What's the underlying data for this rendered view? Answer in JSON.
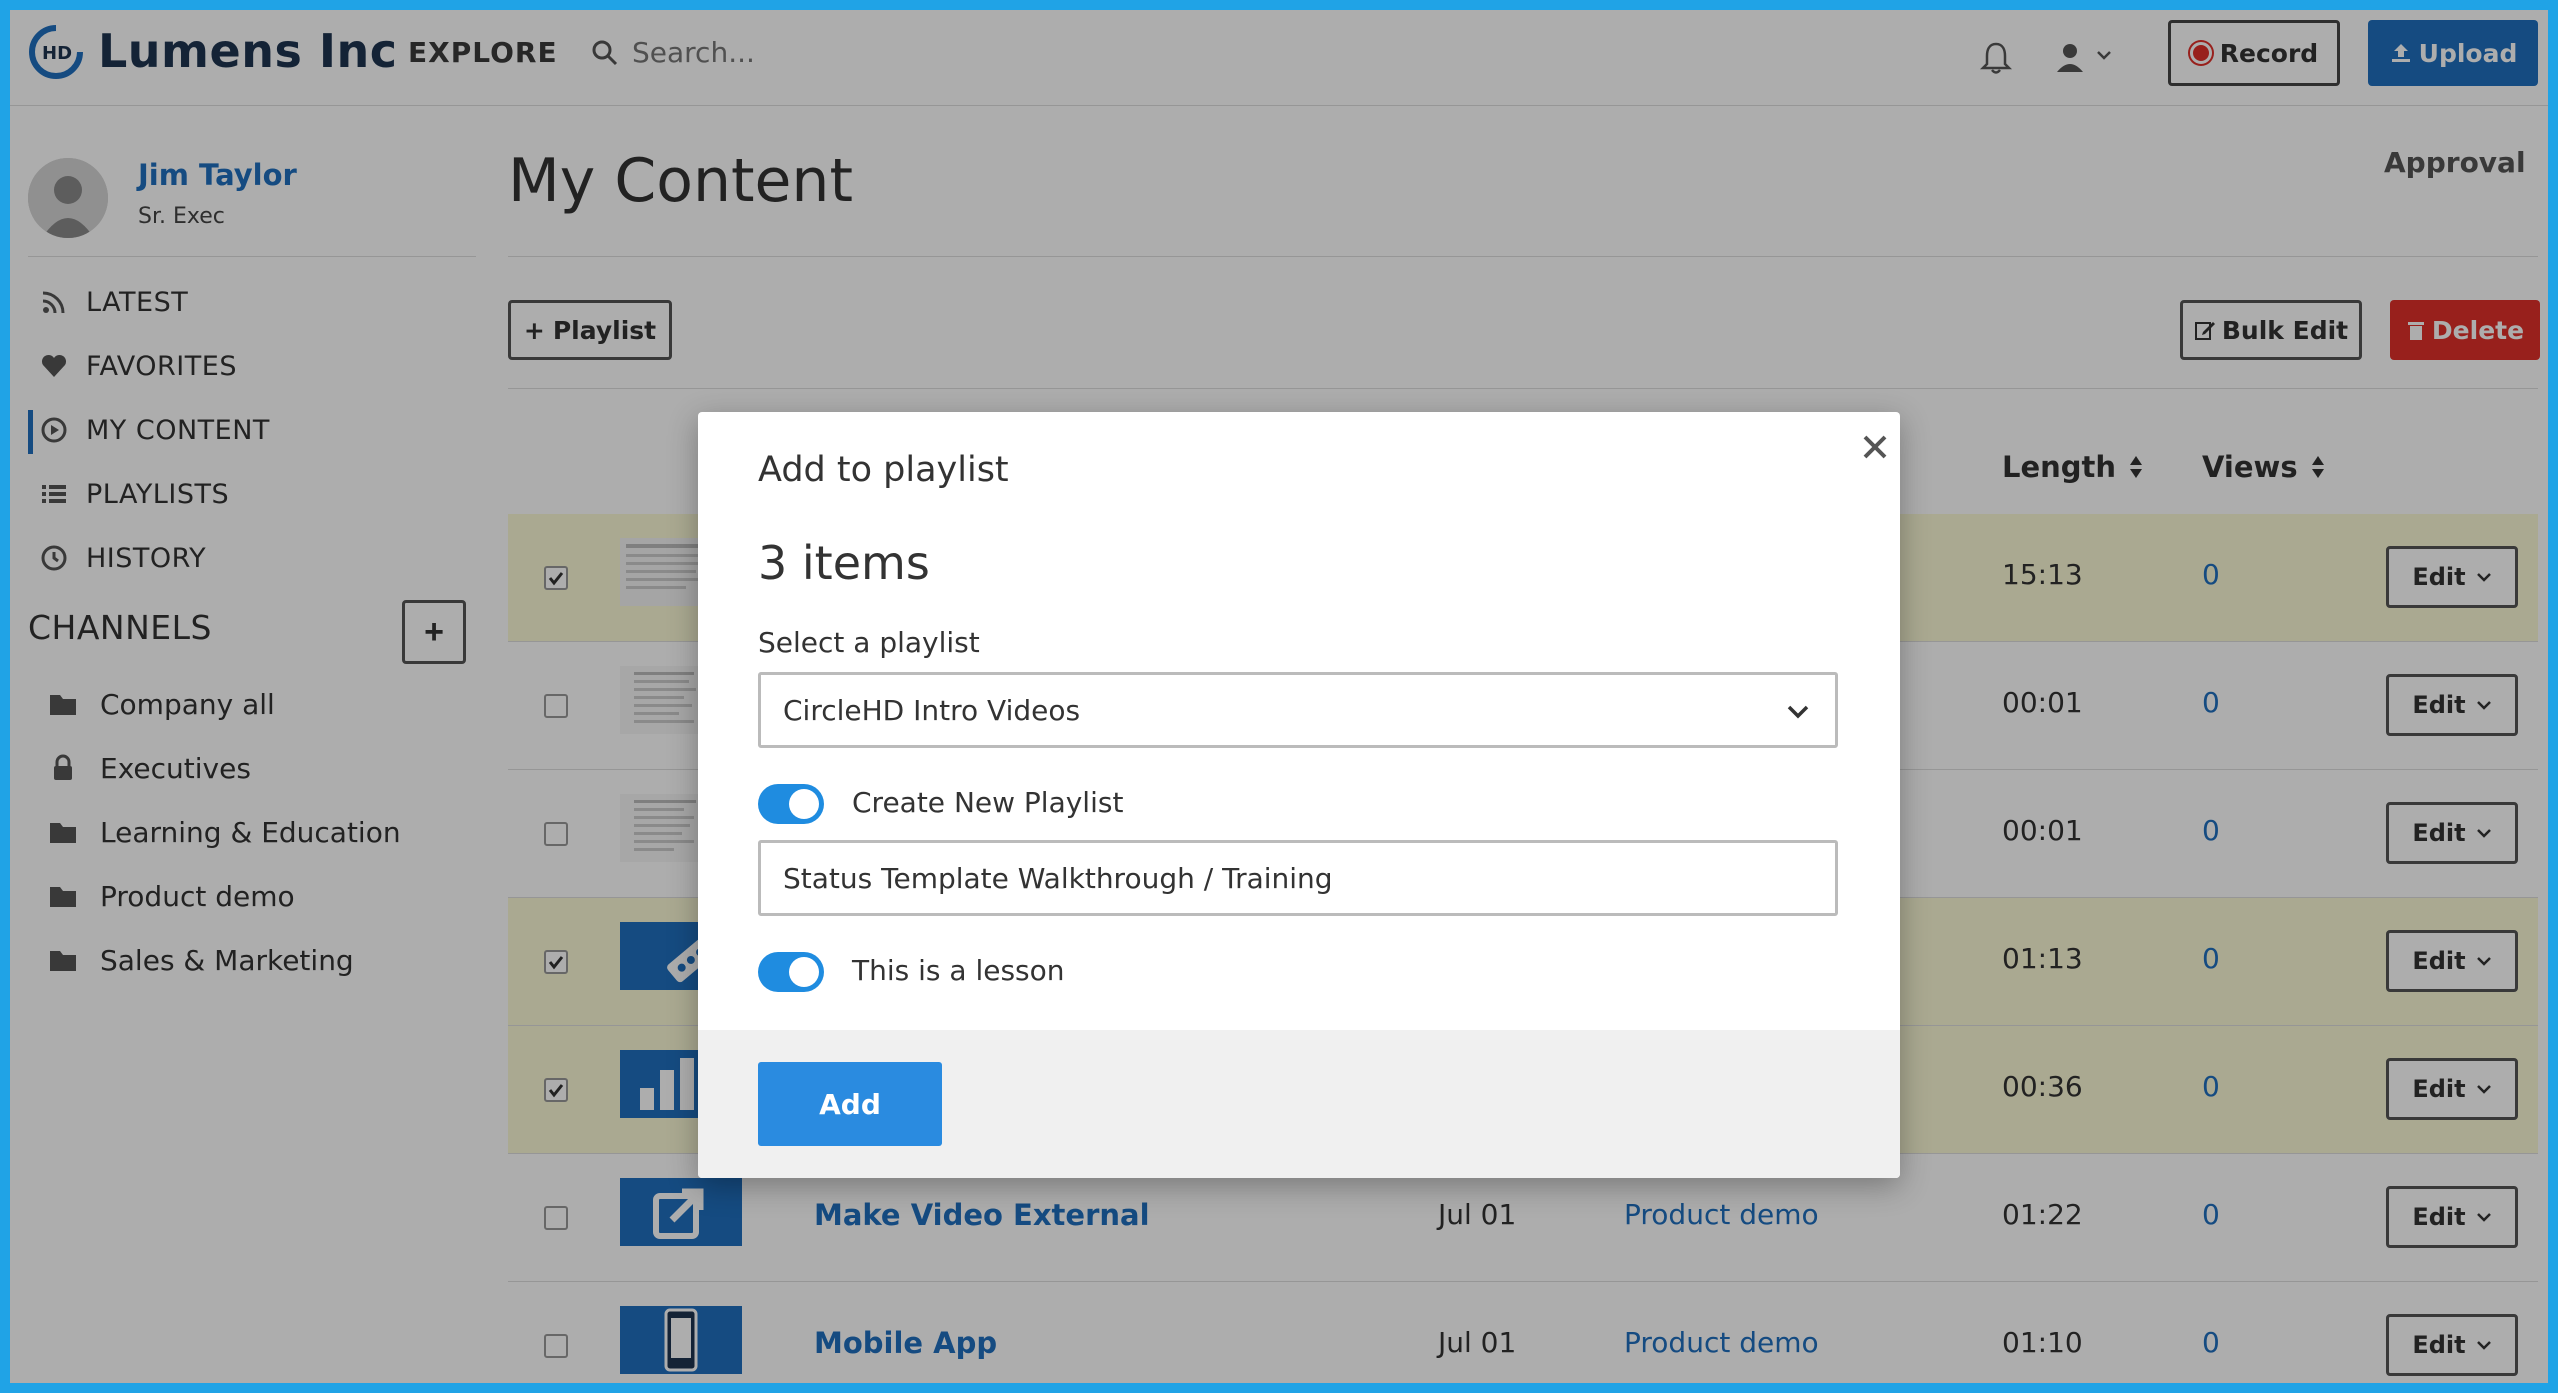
{
  "app": {
    "brand": "Lumens Inc",
    "logo_text": "HD",
    "explore_label": "EXPLORE",
    "search_placeholder": "Search...",
    "record_label": "Record",
    "upload_label": "Upload"
  },
  "profile": {
    "name": "Jim Taylor",
    "role": "Sr. Exec"
  },
  "nav": [
    {
      "label": "LATEST",
      "icon": "rss-icon"
    },
    {
      "label": "FAVORITES",
      "icon": "heart-icon"
    },
    {
      "label": "MY CONTENT",
      "icon": "play-circle-icon",
      "active": true
    },
    {
      "label": "PLAYLISTS",
      "icon": "list-icon"
    },
    {
      "label": "HISTORY",
      "icon": "clock-icon"
    }
  ],
  "channels": {
    "title": "CHANNELS",
    "add_label": "+",
    "items": [
      {
        "label": "Company all",
        "icon": "folder-icon"
      },
      {
        "label": "Executives",
        "icon": "lock-icon"
      },
      {
        "label": "Learning & Education",
        "icon": "folder-icon"
      },
      {
        "label": "Product demo",
        "icon": "folder-icon"
      },
      {
        "label": "Sales & Marketing",
        "icon": "folder-icon"
      }
    ]
  },
  "main": {
    "title": "My Content",
    "approval_label": "Approval",
    "playlist_button": "Playlist",
    "bulk_edit_button": "Bulk Edit",
    "delete_button": "Delete",
    "columns": {
      "length": "Length",
      "views": "Views"
    },
    "edit_label": "Edit",
    "rows": [
      {
        "selected": true,
        "title": "",
        "date": "",
        "channel": "",
        "length": "15:13",
        "views": "0",
        "thumb": "document"
      },
      {
        "selected": false,
        "title": "",
        "date": "",
        "channel": "",
        "length": "00:01",
        "views": "0",
        "thumb": "document"
      },
      {
        "selected": false,
        "title": "",
        "date": "",
        "channel": "",
        "length": "00:01",
        "views": "0",
        "thumb": "document"
      },
      {
        "selected": true,
        "title": "",
        "date": "",
        "channel": "",
        "length": "01:13",
        "views": "0",
        "thumb": "blue"
      },
      {
        "selected": true,
        "title": "",
        "date": "",
        "channel": "",
        "length": "00:36",
        "views": "0",
        "thumb": "blue"
      },
      {
        "selected": false,
        "title": "Make Video External",
        "date": "Jul 01",
        "channel": "Product demo",
        "length": "01:22",
        "views": "0",
        "thumb": "blue"
      },
      {
        "selected": false,
        "title": "Mobile App",
        "date": "Jul 01",
        "channel": "Product demo",
        "length": "01:10",
        "views": "0",
        "thumb": "blue"
      }
    ]
  },
  "modal": {
    "title": "Add to playlist",
    "count": "3 items",
    "select_label": "Select a playlist",
    "select_value": "CircleHD Intro Videos",
    "create_new_label": "Create New Playlist",
    "create_new_on": true,
    "new_name_value": "Status Template Walkthrough / Training",
    "lesson_label": "This is a lesson",
    "lesson_on": true,
    "add_button": "Add"
  },
  "colors": {
    "accent": "#1f6fbf",
    "frame": "#20a3e6",
    "danger": "#e0302a",
    "toggle": "#1f8ce0",
    "selected_row": "#fbf9d6"
  }
}
